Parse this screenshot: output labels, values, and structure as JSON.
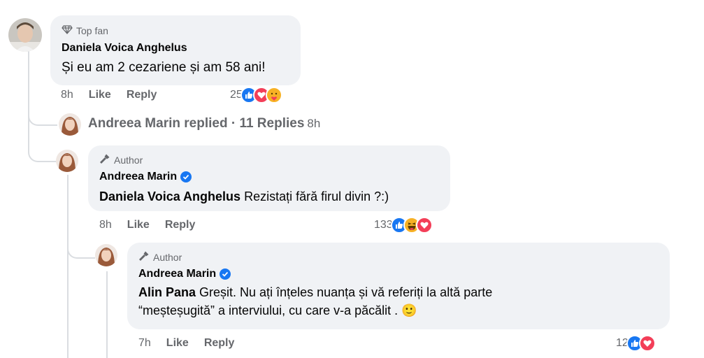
{
  "comments": [
    {
      "badge": "Top fan",
      "author": "Daniela Voica Anghelus",
      "text": "Și eu am 2 cezariene și am 58 ani!",
      "time": "8h",
      "like_label": "Like",
      "reply_label": "Reply",
      "reaction_count": "25",
      "reactions": [
        "like-icon",
        "love-icon",
        "care-icon"
      ]
    },
    {
      "badge": "Author",
      "author": "Andreea Marin",
      "mention": "Daniela Voica Anghelus",
      "text": " Rezistați fără firul divin ?:)",
      "time": "8h",
      "like_label": "Like",
      "reply_label": "Reply",
      "reaction_count": "133",
      "reactions": [
        "like-icon",
        "haha-icon",
        "love-icon"
      ]
    },
    {
      "badge": "Author",
      "author": "Andreea Marin",
      "mention": "Alin Pana",
      "text_line1": " Greșit. Nu ați înțeles nuanța și vă referiți la altă parte",
      "text_line2": "“meșteșugită” a interviului, cu care v-a păcălit . ",
      "emoji": "🙂",
      "time": "7h",
      "like_label": "Like",
      "reply_label": "Reply",
      "reaction_count": "12",
      "reactions": [
        "like-icon",
        "love-icon"
      ]
    }
  ],
  "replies_summary": {
    "author": "Andreea Marin",
    "text": "Andreea Marin replied · 11 Replies",
    "time": "8h"
  },
  "colors": {
    "bubble": "#f0f2f5",
    "secondary_text": "#65676b",
    "like_blue": "#1877f2",
    "love_red": "#f33e58",
    "haha_yellow": "#f7b125"
  }
}
